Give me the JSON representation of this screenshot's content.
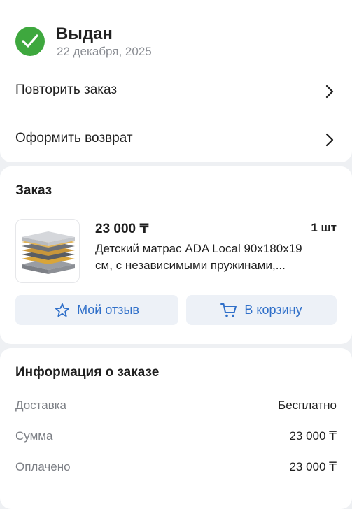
{
  "status": {
    "title": "Выдан",
    "date": "22 декабря, 2025",
    "color": "#3ea83e"
  },
  "actions": {
    "repeat_label": "Повторить заказ",
    "return_label": "Оформить возврат"
  },
  "order": {
    "section_title": "Заказ",
    "item": {
      "price": "23 000 ₸",
      "quantity": "1 шт",
      "name_line1": "Детский матрас ADA Local 90x180x19",
      "name_line2": "см, с независимыми пружинами,..."
    },
    "review_label": "Мой отзыв",
    "cart_label": "В корзину",
    "accent_color": "#2f6fc9"
  },
  "info": {
    "section_title": "Информация о заказе",
    "rows": [
      {
        "key": "Доставка",
        "value": "Бесплатно"
      },
      {
        "key": "Сумма",
        "value": "23 000 ₸"
      },
      {
        "key": "Оплачено",
        "value": "23 000 ₸"
      }
    ]
  }
}
